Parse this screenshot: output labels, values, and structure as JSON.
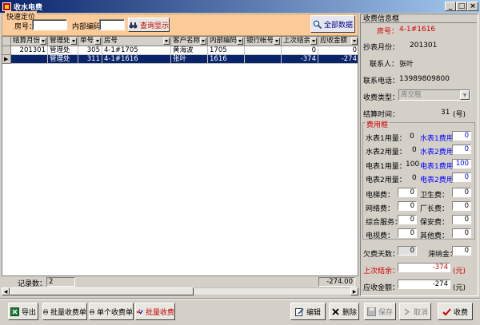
{
  "window": {
    "title": "收水电费"
  },
  "quick": {
    "section_title": "快速定位",
    "room_label": "房号：",
    "code_label": "内部编码：",
    "search_btn": "查询显示",
    "all_btn": "全部数据"
  },
  "grid": {
    "columns": [
      "结算月份",
      "管理处",
      "单号",
      "房号",
      "客户名称",
      "内部编码",
      "银行帐号",
      "上次结余",
      "应收金额"
    ],
    "rows": [
      [
        "201301",
        "管理处",
        "305",
        "4-1#1705",
        "黄海波",
        "1705",
        "",
        "0",
        "0"
      ],
      [
        "",
        "管理处",
        "311",
        "4-1#1616",
        "张叶",
        "1616",
        "",
        "-374",
        "-274"
      ]
    ]
  },
  "status": {
    "count_label": "记录数：",
    "count": "2",
    "total": "-274.00"
  },
  "toolbar": {
    "export": "导出",
    "batch_receipt": "批量收费单",
    "single_receipt": "单个收费单",
    "batch_charge": "批量收费",
    "edit": "编辑",
    "delete": "删除",
    "save": "保存",
    "cancel": "取消",
    "charge": "收费"
  },
  "info": {
    "section_title": "收费信息框",
    "room_label": "房号：",
    "room_value": "4-1#1616",
    "meter_month_label": "抄表月份：",
    "meter_month_value": "201301",
    "contact_label": "联系人：",
    "contact_value": "张叶",
    "phone_label": "联系电话：",
    "phone_value": "13989809800",
    "type_label": "收费类型：",
    "type_value": "库交租",
    "settle_label": "结算时间：",
    "settle_value": "31",
    "settle_unit": "(号)",
    "fee_title": "费用框",
    "water1_label": "水表1用量：",
    "water1_value": "0",
    "water1_fee_label": "水表1费用",
    "water1_fee": "0",
    "water2_label": "水表2用量：",
    "water2_value": "0",
    "water2_fee_label": "水表2费用",
    "water2_fee": "0",
    "elec1_label": "电表1用量：",
    "elec1_value": "100",
    "elec1_fee_label": "电表1费用",
    "elec1_fee": "100",
    "elec2_label": "电表2用量：",
    "elec2_value": "0",
    "elec2_fee_label": "电表2费用",
    "elec2_fee": "0",
    "elevator_label": "电梯费：",
    "elevator": "0",
    "sanitation_label": "卫生费：",
    "sanitation": "0",
    "network_label": "网络费：",
    "network": "0",
    "factory_label": "厂长费：",
    "factory": "0",
    "service_label": "综合服务：",
    "service": "0",
    "security_label": "保安费：",
    "security": "0",
    "tv_label": "电视费：",
    "tv": "0",
    "other_label": "其他费：",
    "other": "0",
    "overdue_days_label": "欠费天数：",
    "overdue_days": "0",
    "late_fee_label": "滞纳金：",
    "late_fee": "0",
    "last_balance_label": "上次结余：",
    "last_balance": "-374",
    "yuan": "(元)",
    "receivable_label": "应收金额：",
    "receivable": "-274",
    "yuan2": "(元)"
  }
}
